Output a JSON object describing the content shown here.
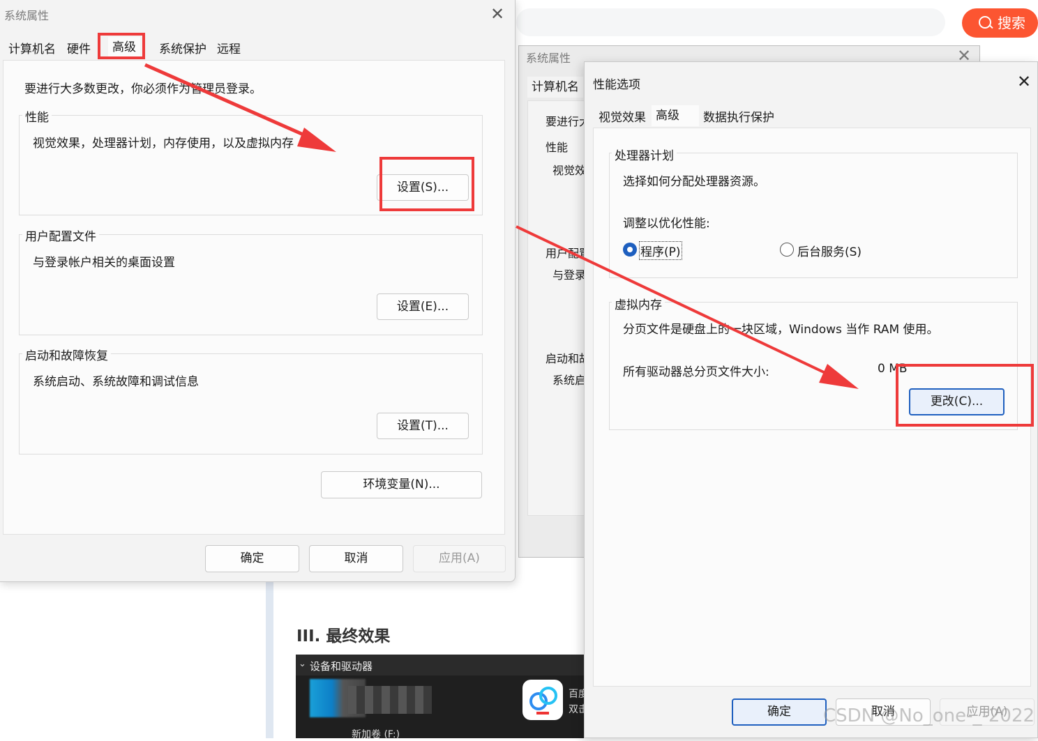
{
  "browser": {
    "search_label": "搜索"
  },
  "article": {
    "heading": "III. 最终效果",
    "explorer_section": "设备和驱动器",
    "drive_label": "新加卷 (F:)",
    "app_label_top": "百度",
    "app_label_bottom": "双击"
  },
  "sysprops_left": {
    "title": "系统属性",
    "tabs": [
      "计算机名",
      "硬件",
      "高级",
      "系统保护",
      "远程"
    ],
    "admin_note": "要进行大多数更改，你必须作为管理员登录。",
    "performance": {
      "label": "性能",
      "desc": "视觉效果，处理器计划，内存使用，以及虚拟内存",
      "button": "设置(S)..."
    },
    "user_profiles": {
      "label": "用户配置文件",
      "desc": "与登录帐户相关的桌面设置",
      "button": "设置(E)..."
    },
    "startup": {
      "label": "启动和故障恢复",
      "desc": "系统启动、系统故障和调试信息",
      "button": "设置(T)..."
    },
    "env_button": "环境变量(N)...",
    "ok": "确定",
    "cancel": "取消",
    "apply": "应用(A)"
  },
  "sysprops_back": {
    "title": "系统属性",
    "tab_visible": "计算机名",
    "frag_admin": "要进行大",
    "frag_perf": "性能",
    "frag_perf_desc": "视觉效",
    "frag_user": "用户配置",
    "frag_user_desc": "与登录",
    "frag_startup": "启动和故",
    "frag_startup_desc": "系统启"
  },
  "perf_options": {
    "title": "性能选项",
    "tabs": [
      "视觉效果",
      "高级",
      "数据执行保护"
    ],
    "cpu_group": {
      "label": "处理器计划",
      "desc": "选择如何分配处理器资源。",
      "adjust_label": "调整以优化性能:",
      "radio_programs": "程序(P)",
      "radio_services": "后台服务(S)",
      "selected": "程序(P)"
    },
    "vm_group": {
      "label": "虚拟内存",
      "desc": "分页文件是硬盘上的一块区域，Windows 当作 RAM 使用。",
      "total_label": "所有驱动器总分页文件大小:",
      "total_value": "0 MB",
      "change_button": "更改(C)..."
    },
    "ok": "确定",
    "cancel": "取消",
    "apply": "应用(A)"
  },
  "watermark": "CSDN @No_one-_-2022",
  "colors": {
    "annotation_red": "#ee3a3a",
    "search_orange": "#fc5531",
    "accent_blue": "#1e5fbf"
  }
}
